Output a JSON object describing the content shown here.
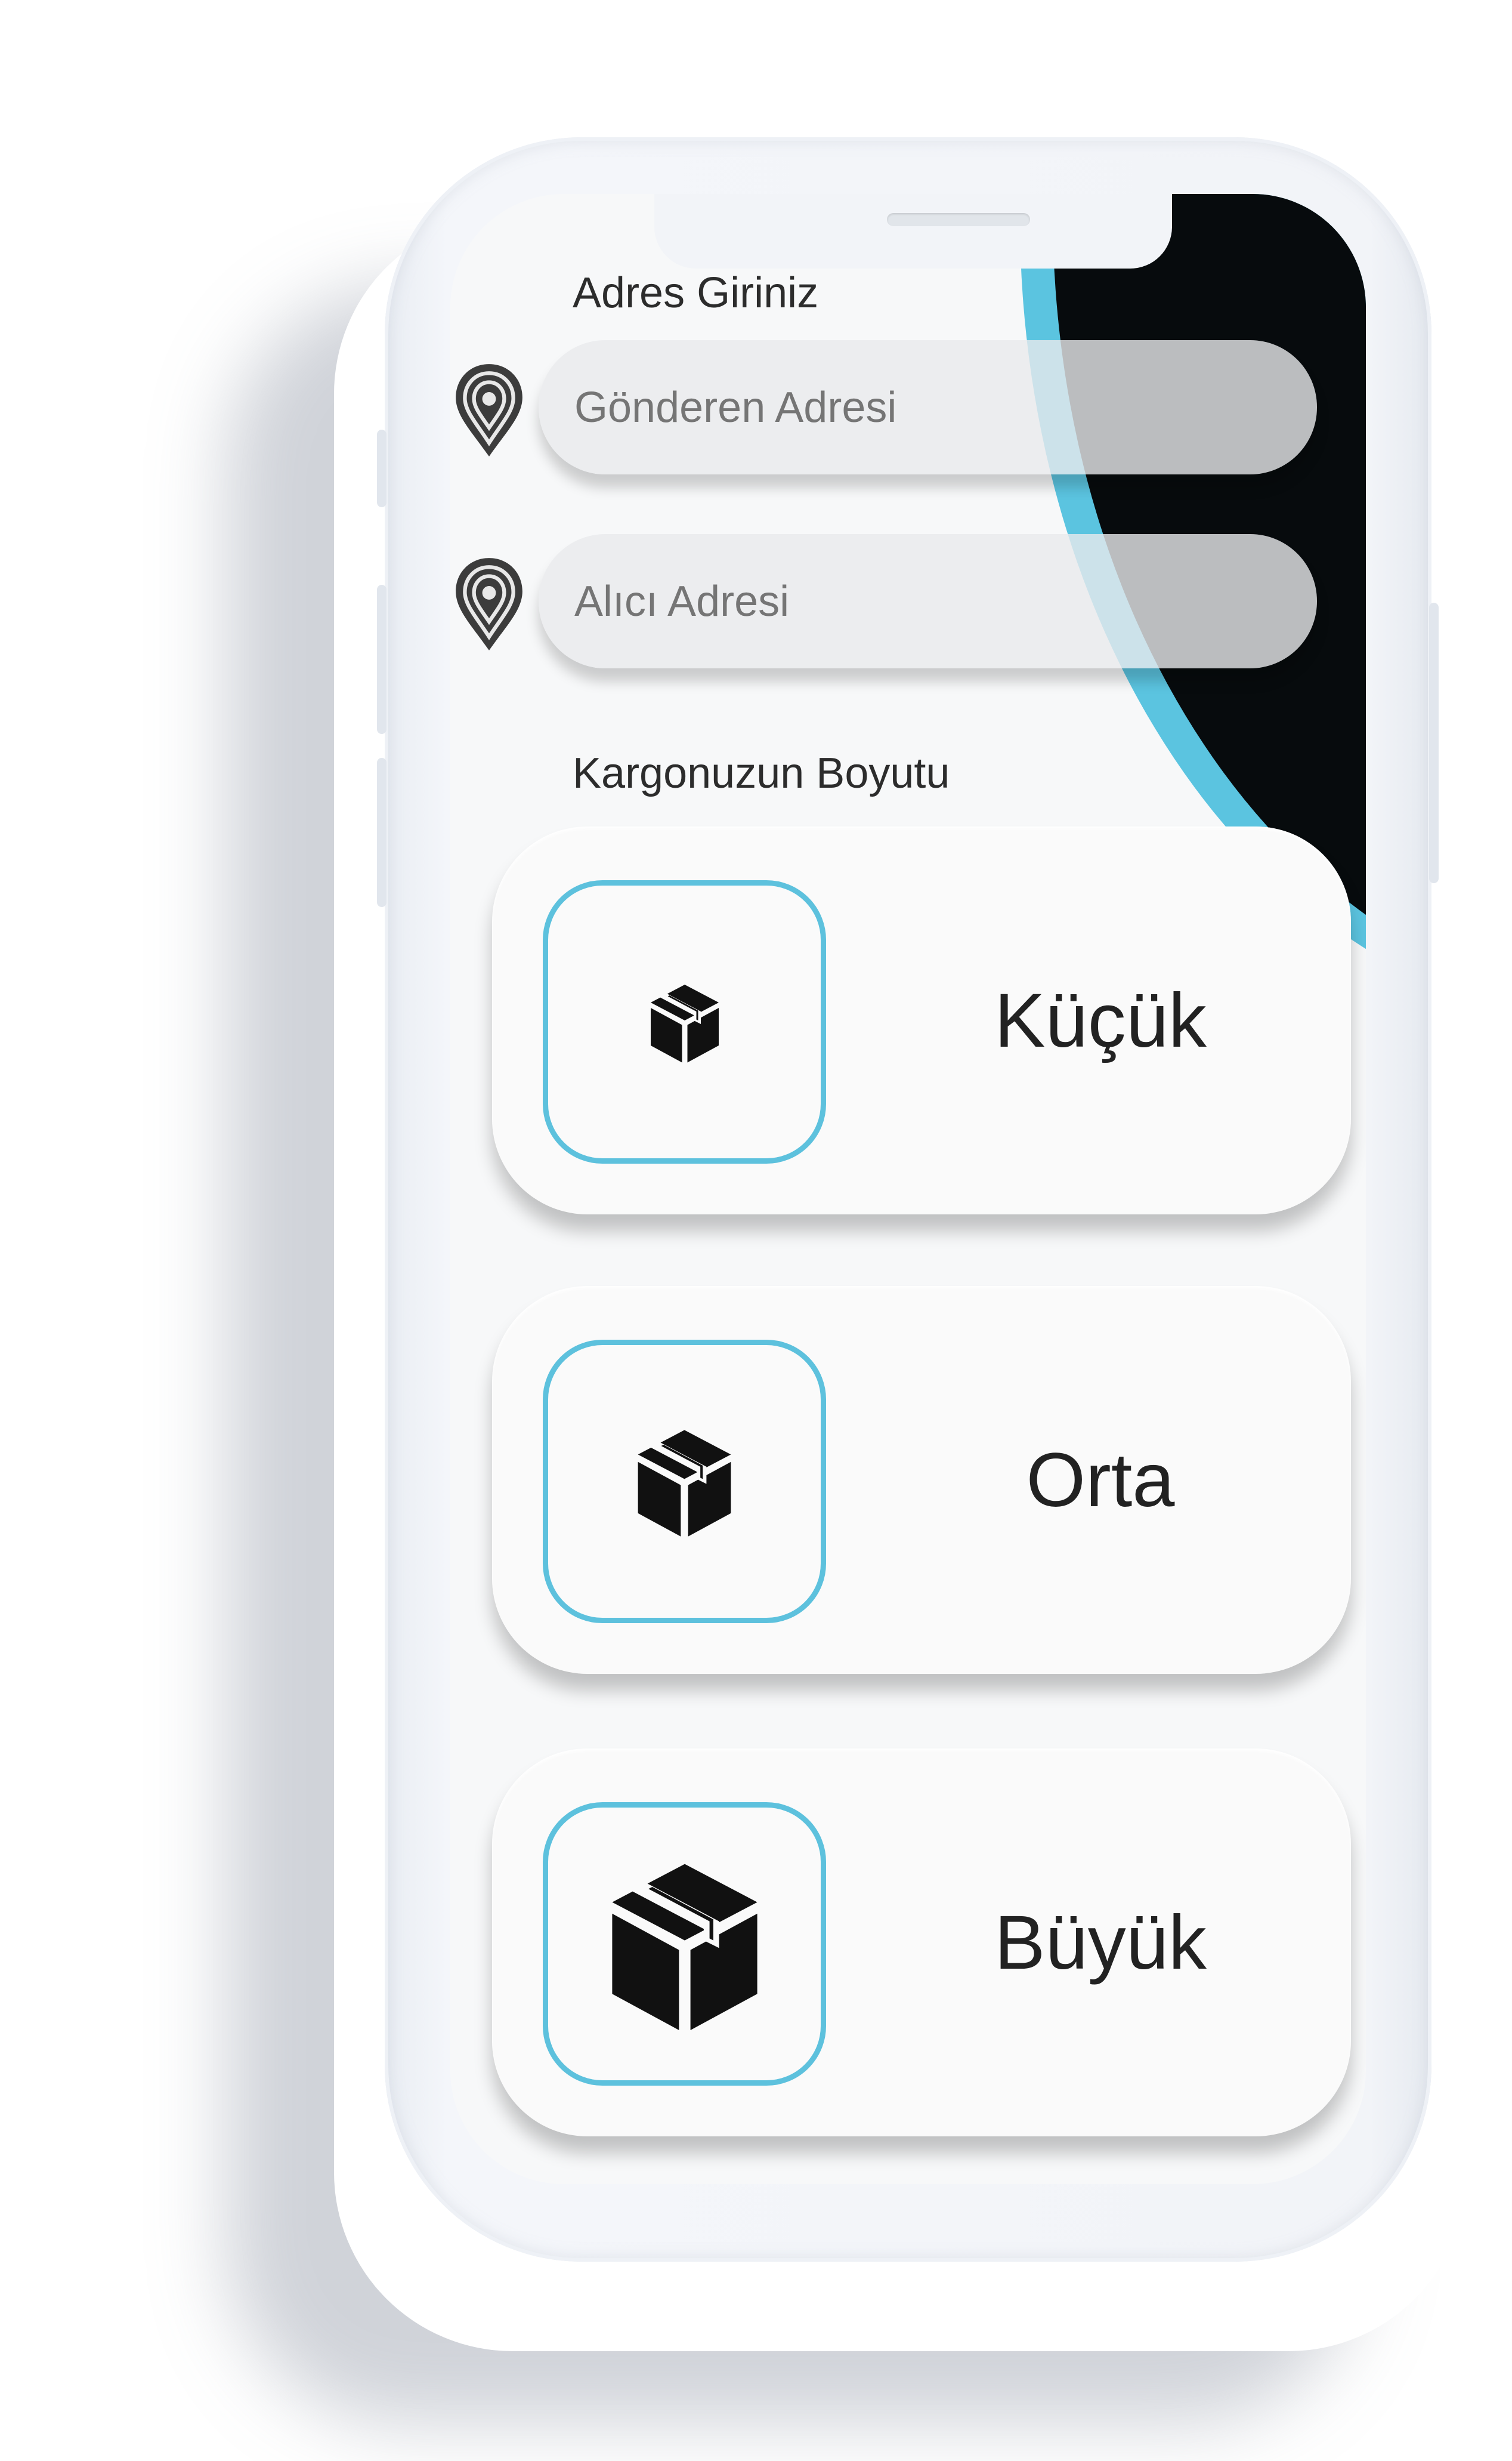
{
  "address_section": {
    "label": "Adres Giriniz",
    "sender_placeholder": "Gönderen Adresi",
    "receiver_placeholder": "Alıcı Adresi"
  },
  "size_section": {
    "label": "Kargonuzun Boyutu",
    "options": [
      {
        "label": "Küçük",
        "icon": "box-small-icon"
      },
      {
        "label": "Orta",
        "icon": "box-medium-icon"
      },
      {
        "label": "Büyük",
        "icon": "box-large-icon"
      }
    ]
  },
  "colors": {
    "accent": "#5bc4e0",
    "dark": "#070b0d",
    "card": "#fafafa",
    "field": "#e8eaec"
  }
}
